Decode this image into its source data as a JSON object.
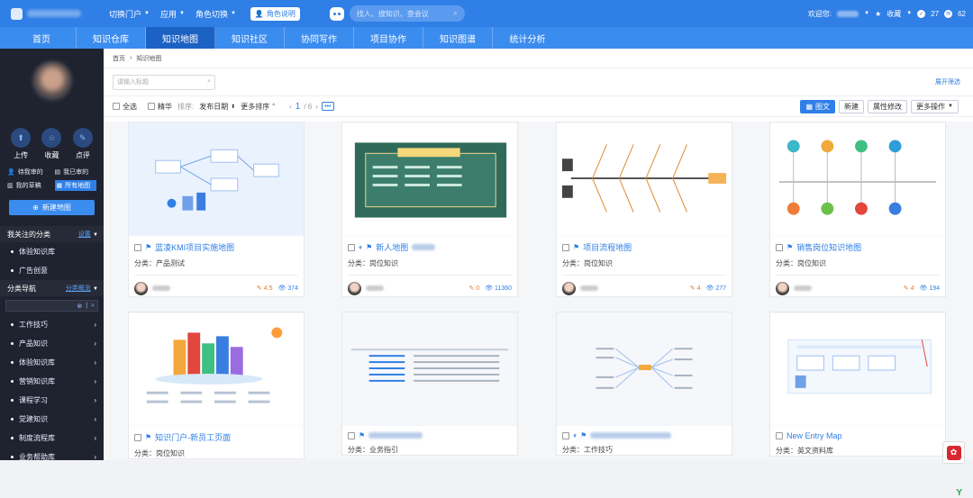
{
  "header": {
    "menus": [
      {
        "label": "切换门户"
      },
      {
        "label": "应用"
      },
      {
        "label": "角色切换"
      }
    ],
    "role_badge": "角色说明",
    "search_placeholder": "找人、搜知识、查会议",
    "welcome": "欢迎您:",
    "favorites": "收藏",
    "badge_count_1": "27",
    "badge_count_2": "62"
  },
  "nav": {
    "tabs": [
      "首页",
      "知识仓库",
      "知识地图",
      "知识社区",
      "协同写作",
      "项目协作",
      "知识图谱",
      "统计分析"
    ],
    "active": 2
  },
  "sidebar": {
    "actions": [
      "上传",
      "收藏",
      "点评"
    ],
    "links": [
      "待我审的",
      "我已审的",
      "我的草稿",
      "所有地图"
    ],
    "new_button": "新建地图",
    "followed_title": "我关注的分类",
    "followed_link": "设置",
    "followed_items": [
      "体验知识库",
      "广告创意"
    ],
    "category_title": "分类导航",
    "category_link": "分类概览",
    "category_items": [
      "工作技巧",
      "产品知识",
      "体验知识库",
      "营销知识库",
      "课程学习",
      "党建知识",
      "制度流程库",
      "业务帮助库"
    ]
  },
  "main": {
    "breadcrumb": [
      "首页",
      "知识地图"
    ],
    "search_placeholder": "请输入标题",
    "expand_filter": "展开筛选",
    "toolbar": {
      "select_all": "全选",
      "featured": "精华",
      "sort_label": "排序:",
      "sort_field": "发布日期",
      "more_sort": "更多排序",
      "page_current": "1",
      "page_total": "/ 6",
      "page_more": "•••",
      "btn_view": "图文",
      "btn_new": "新建",
      "btn_props": "属性修改",
      "btn_more": "更多操作"
    },
    "cards": [
      {
        "title": "蓝凌KMI项目实施地图",
        "category": "分类：产品测试",
        "edits": "4.5",
        "views": "374"
      },
      {
        "title": "新人地图",
        "category": "分类：岗位知识",
        "edits": "0",
        "views": "11360"
      },
      {
        "title": "项目流程地图",
        "category": "分类：岗位知识",
        "edits": "4",
        "views": "277"
      },
      {
        "title": "销售岗位知识地图",
        "category": "分类：岗位知识",
        "edits": "4",
        "views": "194"
      },
      {
        "title": "知识门户-新员工页面",
        "category": "分类：岗位知识"
      },
      {
        "title": "",
        "category": "分类：业务指引"
      },
      {
        "title": "",
        "category": "分类：工作技巧"
      },
      {
        "title": "New Entry Map",
        "category": "分类：英文资料库"
      }
    ]
  },
  "colors": {
    "primary": "#2f7fe6",
    "nav": "#3b8cef",
    "nav_active": "#1c62c4",
    "sidebar": "#1f2330"
  }
}
